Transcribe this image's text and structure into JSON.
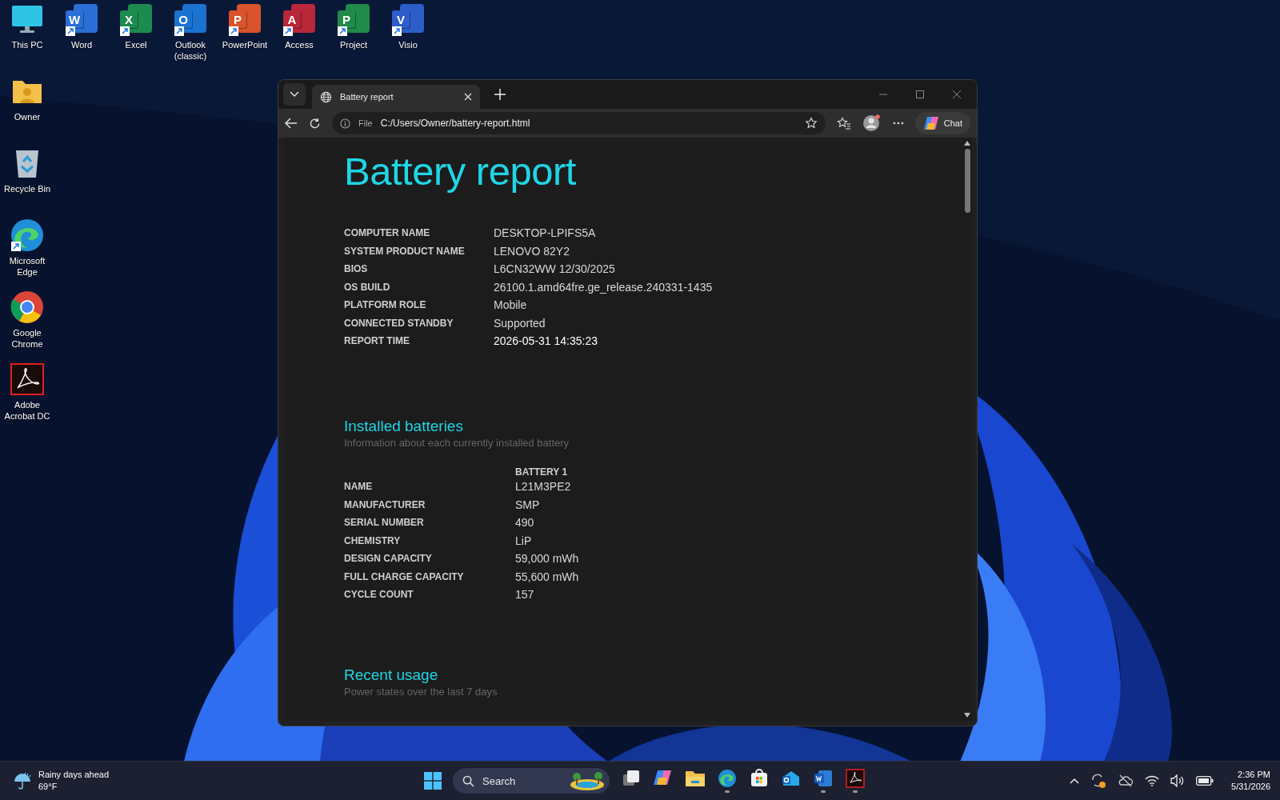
{
  "desktop_icons": [
    {
      "label": "This PC",
      "kind": "monitor"
    },
    {
      "label": "Word",
      "kind": "office",
      "letter": "W",
      "color": "#2b6fd6"
    },
    {
      "label": "Excel",
      "kind": "office",
      "letter": "X",
      "color": "#1d8a4e"
    },
    {
      "label": "Outlook (classic)",
      "kind": "office",
      "letter": "O",
      "color": "#1a73d1"
    },
    {
      "label": "PowerPoint",
      "kind": "office",
      "letter": "P",
      "color": "#d9542c"
    },
    {
      "label": "Access",
      "kind": "office",
      "letter": "A",
      "color": "#b8283a"
    },
    {
      "label": "Project",
      "kind": "office",
      "letter": "P",
      "color": "#1f8a4a"
    },
    {
      "label": "Visio",
      "kind": "office",
      "letter": "V",
      "color": "#2c5dc9"
    },
    {
      "label": "Owner",
      "kind": "folder"
    },
    {
      "label": "Recycle Bin",
      "kind": "bin"
    },
    {
      "label": "Microsoft Edge",
      "kind": "edge"
    },
    {
      "label": "Google Chrome",
      "kind": "chrome"
    },
    {
      "label": "Adobe Acrobat DC",
      "kind": "acrobat"
    }
  ],
  "browser": {
    "tab": {
      "title": "Battery report",
      "selected": true
    },
    "address": {
      "scheme": "File",
      "url": "C:/Users/Owner/battery-report.html"
    },
    "chat_label": "Chat"
  },
  "report": {
    "title": "Battery report",
    "system_info": [
      {
        "label": "COMPUTER NAME",
        "value": "DESKTOP-LPIFS5A"
      },
      {
        "label": "SYSTEM PRODUCT NAME",
        "value": "LENOVO 82Y2"
      },
      {
        "label": "BIOS",
        "value": "L6CN32WW 12/30/2025"
      },
      {
        "label": "OS BUILD",
        "value": "26100.1.amd64fre.ge_release.240331-1435"
      },
      {
        "label": "PLATFORM ROLE",
        "value": "Mobile"
      },
      {
        "label": "CONNECTED STANDBY",
        "value": "Supported"
      },
      {
        "label": "REPORT TIME",
        "value": "2026-05-31  14:35:23"
      }
    ],
    "installed_batteries": {
      "heading": "Installed batteries",
      "subtitle": "Information about each currently installed battery",
      "column": "BATTERY 1",
      "rows": [
        {
          "label": "NAME",
          "value": "L21M3PE2"
        },
        {
          "label": "MANUFACTURER",
          "value": "SMP"
        },
        {
          "label": "SERIAL NUMBER",
          "value": "490"
        },
        {
          "label": "CHEMISTRY",
          "value": "LiP"
        },
        {
          "label": "DESIGN CAPACITY",
          "value": "59,000 mWh"
        },
        {
          "label": "FULL CHARGE CAPACITY",
          "value": "55,600 mWh"
        },
        {
          "label": "CYCLE COUNT",
          "value": "157"
        }
      ]
    },
    "recent_usage": {
      "heading": "Recent usage",
      "subtitle": "Power states over the last 7 days"
    }
  },
  "taskbar": {
    "weather": {
      "text": "Rainy days ahead",
      "temperature": "69°F"
    },
    "search": {
      "placeholder": "Search"
    },
    "apps": [
      {
        "kind": "taskview",
        "running": false
      },
      {
        "kind": "copilot",
        "running": false
      },
      {
        "kind": "explorer",
        "running": false
      },
      {
        "kind": "edge",
        "running": true
      },
      {
        "kind": "store",
        "running": false
      },
      {
        "kind": "outlook",
        "running": false
      },
      {
        "kind": "word",
        "running": true
      },
      {
        "kind": "acrobat",
        "running": true
      }
    ],
    "clock": {
      "time": "2:36 PM",
      "date": "5/31/2026"
    }
  }
}
